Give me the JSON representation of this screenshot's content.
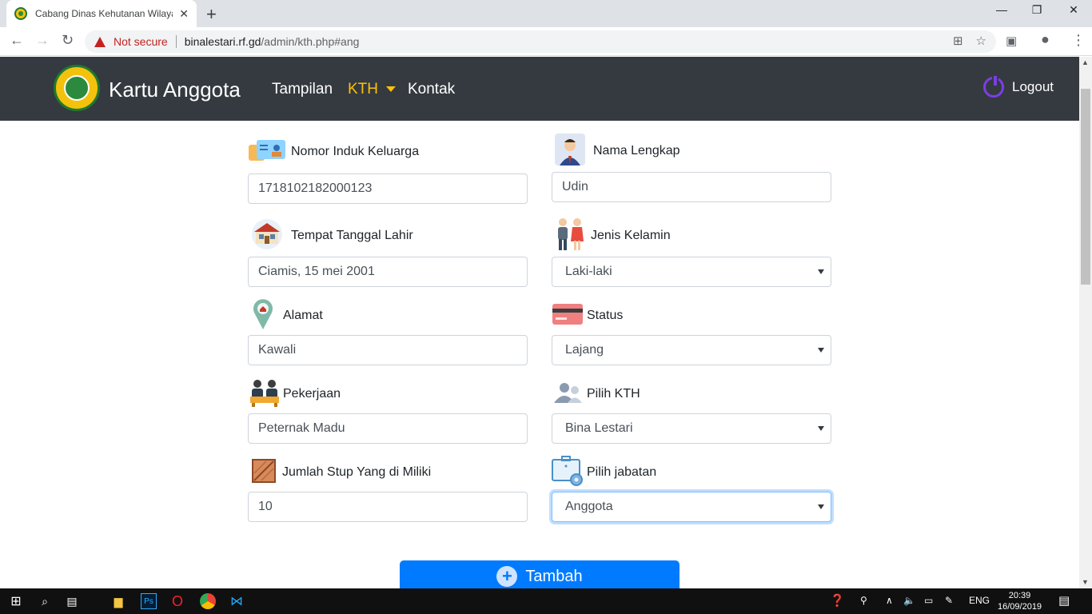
{
  "browser": {
    "tab_title": "Cabang Dinas Kehutanan Wilayah",
    "url_warning": "Not secure",
    "url_host": "binalestari.rf.gd",
    "url_path": "/admin/kth.php#ang"
  },
  "navbar": {
    "brand": "Kartu Anggota",
    "links": [
      "Tampilan",
      "KTH",
      "Kontak"
    ],
    "active_link": "KTH",
    "logout": "Logout"
  },
  "form": {
    "nik": {
      "label": "Nomor Induk Keluarga",
      "value": "1718102182000123"
    },
    "nama": {
      "label": "Nama Lengkap",
      "value": "Udin"
    },
    "ttl": {
      "label": "Tempat Tanggal Lahir",
      "value": "Ciamis, 15 mei 2001"
    },
    "jk": {
      "label": "Jenis Kelamin",
      "value": "Laki-laki"
    },
    "alamat": {
      "label": "Alamat",
      "value": "Kawali"
    },
    "status": {
      "label": "Status",
      "value": "Lajang"
    },
    "pekerjaan": {
      "label": "Pekerjaan",
      "value": "Peternak Madu"
    },
    "kth": {
      "label": "Pilih KTH",
      "value": "Bina Lestari"
    },
    "stup": {
      "label": "Jumlah Stup Yang di Miliki",
      "value": "10"
    },
    "jabatan": {
      "label": "Pilih jabatan",
      "value": "Anggota"
    },
    "submit": "Tambah"
  },
  "taskbar": {
    "lang": "ENG",
    "time": "20:39",
    "date": "16/09/2019"
  },
  "colors": {
    "navbar_bg": "#343a40",
    "active_link": "#ffc107",
    "primary": "#007bff"
  }
}
